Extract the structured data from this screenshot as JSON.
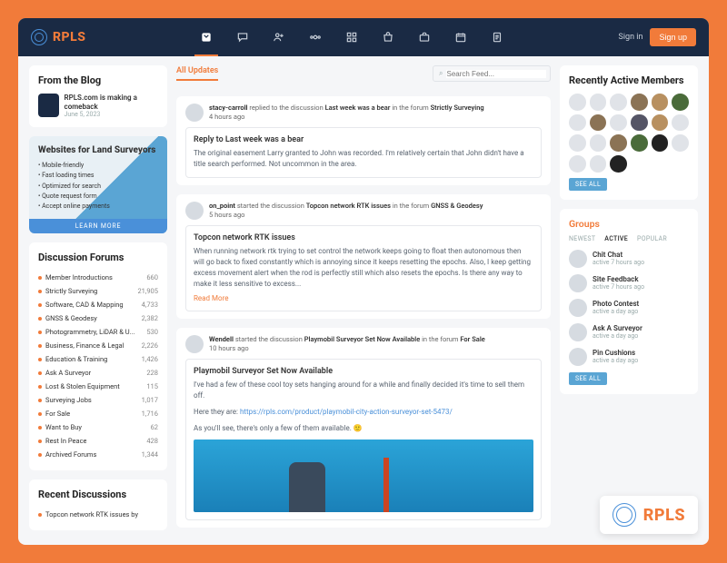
{
  "brand": "RPLS",
  "auth": {
    "signin": "Sign in",
    "signup": "Sign up"
  },
  "blog": {
    "heading": "From the Blog",
    "item": {
      "title": "RPLS.com is making a comeback",
      "date": "June 5, 2023"
    }
  },
  "ad": {
    "title": "Websites for Land Surveyors",
    "bullets": [
      "Mobile-friendly",
      "Fast loading times",
      "Optimized for search",
      "Quote request form",
      "Accept online payments"
    ],
    "cta": "LEARN MORE"
  },
  "forums": {
    "heading": "Discussion Forums",
    "items": [
      {
        "name": "Member Introductions",
        "count": "660"
      },
      {
        "name": "Strictly Surveying",
        "count": "21,905"
      },
      {
        "name": "Software, CAD & Mapping",
        "count": "4,733"
      },
      {
        "name": "GNSS & Geodesy",
        "count": "2,382"
      },
      {
        "name": "Photogrammetry, LiDAR & U...",
        "count": "530"
      },
      {
        "name": "Business, Finance & Legal",
        "count": "2,226"
      },
      {
        "name": "Education & Training",
        "count": "1,426"
      },
      {
        "name": "Ask A Surveyor",
        "count": "228"
      },
      {
        "name": "Lost & Stolen Equipment",
        "count": "115"
      },
      {
        "name": "Surveying Jobs",
        "count": "1,017"
      },
      {
        "name": "For Sale",
        "count": "1,716"
      },
      {
        "name": "Want to Buy",
        "count": "62"
      },
      {
        "name": "Rest In Peace",
        "count": "428"
      },
      {
        "name": "Archived Forums",
        "count": "1,344"
      }
    ]
  },
  "recent": {
    "heading": "Recent Discussions",
    "item": "Topcon network RTK issues by"
  },
  "feed": {
    "tab": "All Updates",
    "search_placeholder": "Search Feed...",
    "posts": [
      {
        "author": "stacy-carroll",
        "verb": "replied to the discussion",
        "subject": "Last week was a bear",
        "forum": "Strictly Surveying",
        "time": "4 hours ago",
        "title": "Reply to Last week was a bear",
        "body": "The original easement Larry granted to John was recorded. I'm relatively certain that John didn't have a title search performed. Not uncommon in the area."
      },
      {
        "author": "on_point",
        "verb": "started the discussion",
        "subject": "Topcon network RTK issues",
        "forum": "GNSS & Geodesy",
        "time": "5 hours ago",
        "title": "Topcon network RTK issues",
        "body": "When running network rtk trying to set control the network keeps going to float then autonomous then will go back to fixed constantly which is annoying since it keeps resetting the epochs. Also, I keep getting excess movement alert when the rod is perfectly still which also resets the epochs. Is there any way to make it less sensitive to excess...",
        "readmore": "Read More"
      },
      {
        "author": "Wendell",
        "verb": "started the discussion",
        "subject": "Playmobil Surveyor Set Now Available",
        "forum": "For Sale",
        "time": "10 hours ago",
        "title": "Playmobil Surveyor Set Now Available",
        "body_a": "I've had a few of these cool toy sets hanging around for a while and finally decided it's time to sell them off.",
        "body_b": "Here they are: ",
        "link": "https://rpls.com/product/playmobil-city-action-surveyor-set-5473/",
        "body_c": "As you'll see, there's only a few of them available. 🙂"
      }
    ]
  },
  "members": {
    "heading": "Recently Active Members",
    "seeall": "SEE ALL"
  },
  "groups": {
    "heading": "Groups",
    "tabs": [
      "NEWEST",
      "ACTIVE",
      "POPULAR"
    ],
    "items": [
      {
        "name": "Chit Chat",
        "meta": "active 7 hours ago"
      },
      {
        "name": "Site Feedback",
        "meta": "active 7 hours ago"
      },
      {
        "name": "Photo Contest",
        "meta": "active a day ago"
      },
      {
        "name": "Ask A Surveyor",
        "meta": "active a day ago"
      },
      {
        "name": "Pin Cushions",
        "meta": "active a day ago"
      }
    ],
    "seeall": "SEE ALL"
  }
}
